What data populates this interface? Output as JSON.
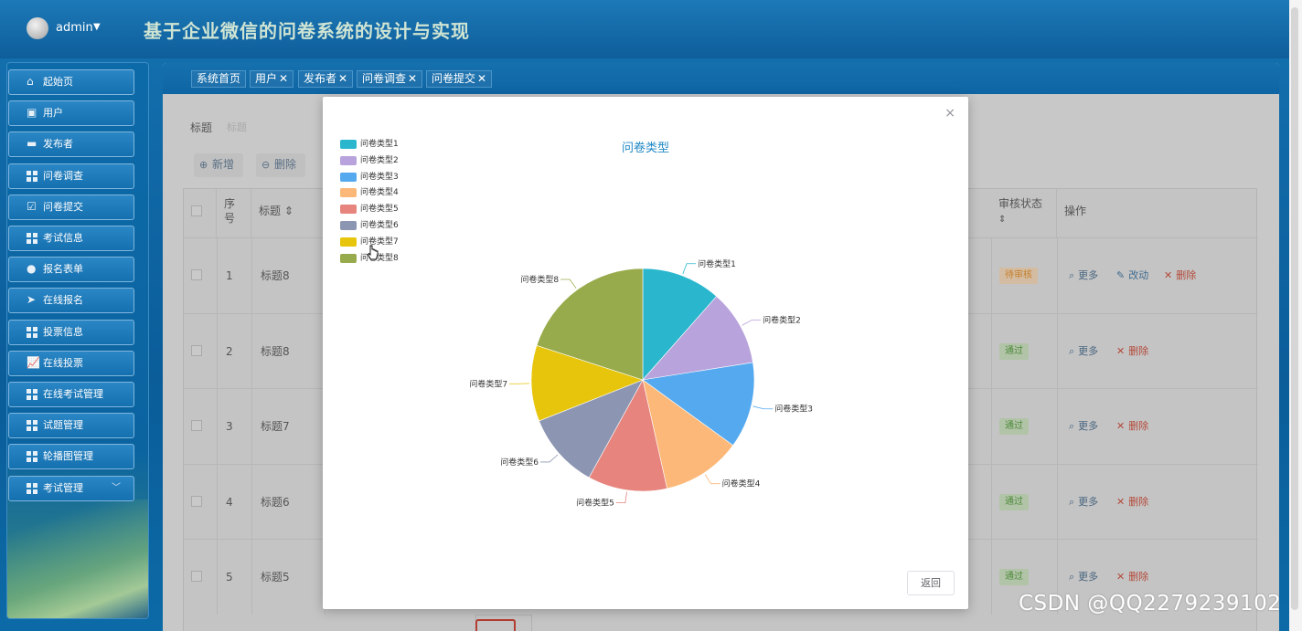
{
  "header": {
    "user": "admin",
    "title": "基于企业微信的问卷系统的设计与实现"
  },
  "sidebar": {
    "items": [
      {
        "label": "起始页",
        "icon": "home-icon"
      },
      {
        "label": "用户",
        "icon": "user-clipboard-icon"
      },
      {
        "label": "发布者",
        "icon": "monitor-icon"
      },
      {
        "label": "问卷调查",
        "icon": "grid-icon"
      },
      {
        "label": "问卷提交",
        "icon": "clipboard-check-icon"
      },
      {
        "label": "考试信息",
        "icon": "grid-icon"
      },
      {
        "label": "报名表单",
        "icon": "person-icon"
      },
      {
        "label": "在线报名",
        "icon": "send-icon"
      },
      {
        "label": "投票信息",
        "icon": "grid-icon"
      },
      {
        "label": "在线投票",
        "icon": "chart-icon"
      },
      {
        "label": "在线考试管理",
        "icon": "grid-icon"
      },
      {
        "label": "试题管理",
        "icon": "grid-icon"
      },
      {
        "label": "轮播图管理",
        "icon": "grid-icon"
      },
      {
        "label": "考试管理",
        "icon": "grid-icon"
      }
    ]
  },
  "tabs": [
    {
      "label": "系统首页",
      "closable": false
    },
    {
      "label": "用户",
      "closable": true
    },
    {
      "label": "发布者",
      "closable": true
    },
    {
      "label": "问卷调查",
      "closable": true
    },
    {
      "label": "问卷提交",
      "closable": true
    }
  ],
  "search": {
    "label": "标题",
    "placeholder": "标题"
  },
  "toolbar": {
    "add_label": "新增",
    "delete_label": "删除"
  },
  "table": {
    "headers": {
      "index": "序号",
      "title": "标题",
      "status": "审核状态",
      "actions": "操作"
    },
    "rows": [
      {
        "index": "1",
        "title": "标题8",
        "status": "待审核",
        "status_type": "wait",
        "actions": [
          "更多",
          "改动",
          "删除"
        ]
      },
      {
        "index": "2",
        "title": "标题8",
        "status": "通过",
        "status_type": "pass",
        "actions": [
          "更多",
          "删除"
        ]
      },
      {
        "index": "3",
        "title": "标题7",
        "status": "通过",
        "status_type": "pass",
        "actions": [
          "更多",
          "删除"
        ]
      },
      {
        "index": "4",
        "title": "标题6",
        "status": "通过",
        "status_type": "pass",
        "actions": [
          "更多",
          "删除"
        ]
      },
      {
        "index": "5",
        "title": "标题5",
        "status": "通过",
        "status_type": "pass",
        "actions": [
          "更多",
          "删除"
        ]
      }
    ]
  },
  "modal": {
    "close_label": "×",
    "return_label": "返回"
  },
  "chart_data": {
    "type": "pie",
    "title": "问卷类型",
    "legend_position": "top-left",
    "categories": [
      "问卷类型1",
      "问卷类型2",
      "问卷类型3",
      "问卷类型4",
      "问卷类型5",
      "问卷类型6",
      "问卷类型7",
      "问卷类型8"
    ],
    "values": [
      11.5,
      11,
      12.5,
      11.5,
      11.5,
      11,
      11,
      20
    ],
    "colors": [
      "#2ab7ce",
      "#b8a3dc",
      "#55a9ef",
      "#fcb878",
      "#e6847d",
      "#8c96b2",
      "#e7c50c",
      "#98ab4c"
    ]
  },
  "watermark": "CSDN @QQ2279239102"
}
